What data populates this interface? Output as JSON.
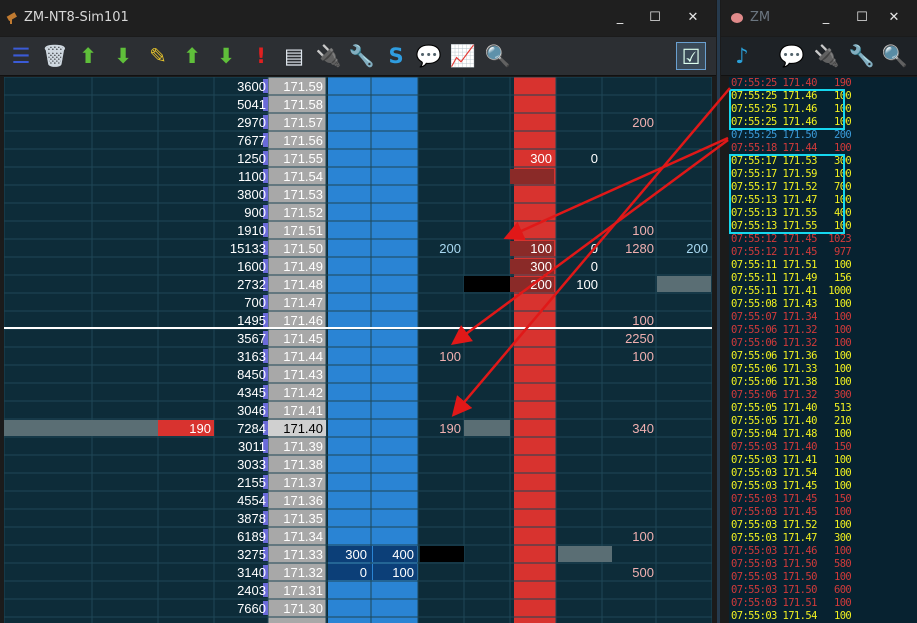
{
  "left_window": {
    "title": "ZM-NT8-Sim101",
    "controls": [
      "_",
      "☐",
      "✕"
    ]
  },
  "right_window": {
    "title": "ZM",
    "controls": [
      "_",
      "☐",
      "✕"
    ]
  },
  "left_toolbar": {
    "icons": [
      {
        "name": "center-ladder-icon",
        "glyph": "☰",
        "color": "#3b5bd6"
      },
      {
        "name": "trash-icon",
        "glyph": "🗑",
        "color": "#cfd8e0"
      },
      {
        "name": "buy-upload-icon",
        "glyph": "⬆",
        "color": "#5fbf3a"
      },
      {
        "name": "sell-download-icon",
        "glyph": "⬇",
        "color": "#5fbf3a"
      },
      {
        "name": "eraser-icon",
        "glyph": "✎",
        "color": "#e3c12c"
      },
      {
        "name": "buy-arrow-up-icon",
        "glyph": "⬆",
        "color": "#5fbf3a"
      },
      {
        "name": "sell-arrow-down-icon",
        "glyph": "⬇",
        "color": "#5fbf3a"
      },
      {
        "name": "alert-exclamation-icon",
        "glyph": "!",
        "color": "#e02020"
      },
      {
        "name": "document-chart-icon",
        "glyph": "▤",
        "color": "#dfe6ee"
      },
      {
        "name": "plug-battery-icon",
        "glyph": "🔌",
        "color": "#e0d070"
      },
      {
        "name": "wrench-icon",
        "glyph": "🔧",
        "color": "#5aa0e8"
      },
      {
        "name": "s-logo-icon",
        "glyph": "S",
        "color": "#2f9de0"
      },
      {
        "name": "chat-bubbles-icon",
        "glyph": "💬",
        "color": "#5fd070"
      },
      {
        "name": "line-chart-icon",
        "glyph": "📈",
        "color": "#d04040"
      },
      {
        "name": "magnifier-icon",
        "glyph": "🔍",
        "color": "#a8d0f0"
      }
    ],
    "right_icon": {
      "name": "settings-list-icon",
      "glyph": "☑"
    }
  },
  "right_toolbar": {
    "icons": [
      {
        "name": "music-note-icon",
        "glyph": "♪",
        "color": "#2aa0d8"
      },
      {
        "name": "chat-bubbles-icon",
        "glyph": "💬",
        "color": "#5fd070"
      },
      {
        "name": "plug-battery-icon",
        "glyph": "🔌",
        "color": "#e0d070"
      },
      {
        "name": "wrench-icon",
        "glyph": "🔧",
        "color": "#5aa0e8"
      },
      {
        "name": "magnifier-icon",
        "glyph": "🔍",
        "color": "#a8d0f0"
      }
    ]
  },
  "ladder": {
    "rows": [
      {
        "vol": "3600",
        "price": "171.59"
      },
      {
        "vol": "5041",
        "price": "171.58"
      },
      {
        "vol": "2970",
        "price": "171.57",
        "col8": "200"
      },
      {
        "vol": "7677",
        "price": "171.56"
      },
      {
        "vol": "1250",
        "price": "171.55",
        "col6": "300",
        "col7": "0"
      },
      {
        "vol": "1100",
        "price": "171.54"
      },
      {
        "vol": "3800",
        "price": "171.53"
      },
      {
        "vol": "900",
        "price": "171.52"
      },
      {
        "vol": "1910",
        "price": "171.51",
        "col8": "100"
      },
      {
        "vol": "15133",
        "price": "171.50",
        "col5": "200",
        "col6": "100",
        "col7": "0",
        "col8": "1280",
        "col9": "200"
      },
      {
        "vol": "1600",
        "price": "171.49",
        "col6": "300",
        "col7": "0"
      },
      {
        "vol": "2732",
        "price": "171.48",
        "col6": "200",
        "col7": "100"
      },
      {
        "vol": "700",
        "price": "171.47"
      },
      {
        "vol": "1495",
        "price": "171.46",
        "col8": "100"
      },
      {
        "vol": "3567",
        "price": "171.45",
        "col8": "2250"
      },
      {
        "vol": "3163",
        "price": "171.44",
        "col5": "100",
        "col8": "100"
      },
      {
        "vol": "8450",
        "price": "171.43"
      },
      {
        "vol": "4345",
        "price": "171.42"
      },
      {
        "vol": "3046",
        "price": "171.41"
      },
      {
        "vol": "7284",
        "price": "171.40",
        "col2": "190",
        "col5": "190",
        "col8": "340"
      },
      {
        "vol": "3011",
        "price": "171.39"
      },
      {
        "vol": "3033",
        "price": "171.38"
      },
      {
        "vol": "2155",
        "price": "171.37"
      },
      {
        "vol": "4554",
        "price": "171.36"
      },
      {
        "vol": "3878",
        "price": "171.35"
      },
      {
        "vol": "6189",
        "price": "171.34",
        "col8": "100"
      },
      {
        "vol": "3275",
        "price": "171.33",
        "col3": "300",
        "col4": "400"
      },
      {
        "vol": "3140",
        "price": "171.32",
        "col3": "0",
        "col4": "100",
        "col8": "500"
      },
      {
        "vol": "2403",
        "price": "171.31"
      },
      {
        "vol": "7660",
        "price": "171.30"
      }
    ]
  },
  "tape": {
    "rows": [
      {
        "t": "07:55:25",
        "p": "171.40",
        "q": "190",
        "c": "#d03a3a"
      },
      {
        "t": "07:55:25",
        "p": "171.46",
        "q": "100",
        "c": "#f0f020"
      },
      {
        "t": "07:55:25",
        "p": "171.46",
        "q": "100",
        "c": "#f0f020"
      },
      {
        "t": "07:55:25",
        "p": "171.46",
        "q": "100",
        "c": "#f0f020"
      },
      {
        "t": "07:55:25",
        "p": "171.50",
        "q": "200",
        "c": "#3a9ad8"
      },
      {
        "t": "07:55:18",
        "p": "171.44",
        "q": "100",
        "c": "#d03a3a"
      },
      {
        "t": "07:55:17",
        "p": "171.53",
        "q": "300",
        "c": "#f0f020"
      },
      {
        "t": "07:55:17",
        "p": "171.59",
        "q": "100",
        "c": "#f0f020"
      },
      {
        "t": "07:55:17",
        "p": "171.52",
        "q": "700",
        "c": "#f0f020"
      },
      {
        "t": "07:55:13",
        "p": "171.47",
        "q": "100",
        "c": "#f0f020"
      },
      {
        "t": "07:55:13",
        "p": "171.55",
        "q": "400",
        "c": "#f0f020"
      },
      {
        "t": "07:55:13",
        "p": "171.55",
        "q": "100",
        "c": "#f0f020"
      },
      {
        "t": "07:55:12",
        "p": "171.45",
        "q": "1023",
        "c": "#d03a3a"
      },
      {
        "t": "07:55:12",
        "p": "171.45",
        "q": "977",
        "c": "#d03a3a"
      },
      {
        "t": "07:55:11",
        "p": "171.51",
        "q": "100",
        "c": "#f0f020"
      },
      {
        "t": "07:55:11",
        "p": "171.49",
        "q": "156",
        "c": "#f0f020"
      },
      {
        "t": "07:55:11",
        "p": "171.41",
        "q": "1000",
        "c": "#f0f020"
      },
      {
        "t": "07:55:08",
        "p": "171.43",
        "q": "100",
        "c": "#f0f020"
      },
      {
        "t": "07:55:07",
        "p": "171.34",
        "q": "100",
        "c": "#d03a3a"
      },
      {
        "t": "07:55:06",
        "p": "171.32",
        "q": "100",
        "c": "#d03a3a"
      },
      {
        "t": "07:55:06",
        "p": "171.32",
        "q": "100",
        "c": "#d03a3a"
      },
      {
        "t": "07:55:06",
        "p": "171.36",
        "q": "100",
        "c": "#f0f020"
      },
      {
        "t": "07:55:06",
        "p": "171.33",
        "q": "100",
        "c": "#f0f020"
      },
      {
        "t": "07:55:06",
        "p": "171.38",
        "q": "100",
        "c": "#f0f020"
      },
      {
        "t": "07:55:06",
        "p": "171.32",
        "q": "300",
        "c": "#d03a3a"
      },
      {
        "t": "07:55:05",
        "p": "171.40",
        "q": "513",
        "c": "#f0f020"
      },
      {
        "t": "07:55:05",
        "p": "171.40",
        "q": "210",
        "c": "#f0f020"
      },
      {
        "t": "07:55:04",
        "p": "171.48",
        "q": "100",
        "c": "#f0f020"
      },
      {
        "t": "07:55:03",
        "p": "171.40",
        "q": "150",
        "c": "#d03a3a"
      },
      {
        "t": "07:55:03",
        "p": "171.41",
        "q": "100",
        "c": "#f0f020"
      },
      {
        "t": "07:55:03",
        "p": "171.54",
        "q": "100",
        "c": "#f0f020"
      },
      {
        "t": "07:55:03",
        "p": "171.45",
        "q": "100",
        "c": "#f0f020"
      },
      {
        "t": "07:55:03",
        "p": "171.45",
        "q": "150",
        "c": "#d03a3a"
      },
      {
        "t": "07:55:03",
        "p": "171.45",
        "q": "100",
        "c": "#d03a3a"
      },
      {
        "t": "07:55:03",
        "p": "171.52",
        "q": "100",
        "c": "#f0f020"
      },
      {
        "t": "07:55:03",
        "p": "171.47",
        "q": "300",
        "c": "#f0f020"
      },
      {
        "t": "07:55:03",
        "p": "171.46",
        "q": "100",
        "c": "#d03a3a"
      },
      {
        "t": "07:55:03",
        "p": "171.50",
        "q": "580",
        "c": "#d03a3a"
      },
      {
        "t": "07:55:03",
        "p": "171.50",
        "q": "100",
        "c": "#d03a3a"
      },
      {
        "t": "07:55:03",
        "p": "171.50",
        "q": "600",
        "c": "#d03a3a"
      },
      {
        "t": "07:55:03",
        "p": "171.51",
        "q": "100",
        "c": "#d03a3a"
      },
      {
        "t": "07:55:03",
        "p": "171.54",
        "q": "100",
        "c": "#f0f020"
      }
    ]
  },
  "colors": {
    "bid_blue": "#2a84d4",
    "ask_red": "#d8332f",
    "price_gray": "#a8a8a8",
    "grid": "#1e4656",
    "highlight": "#16d7ee",
    "arrow": "#e01818"
  }
}
